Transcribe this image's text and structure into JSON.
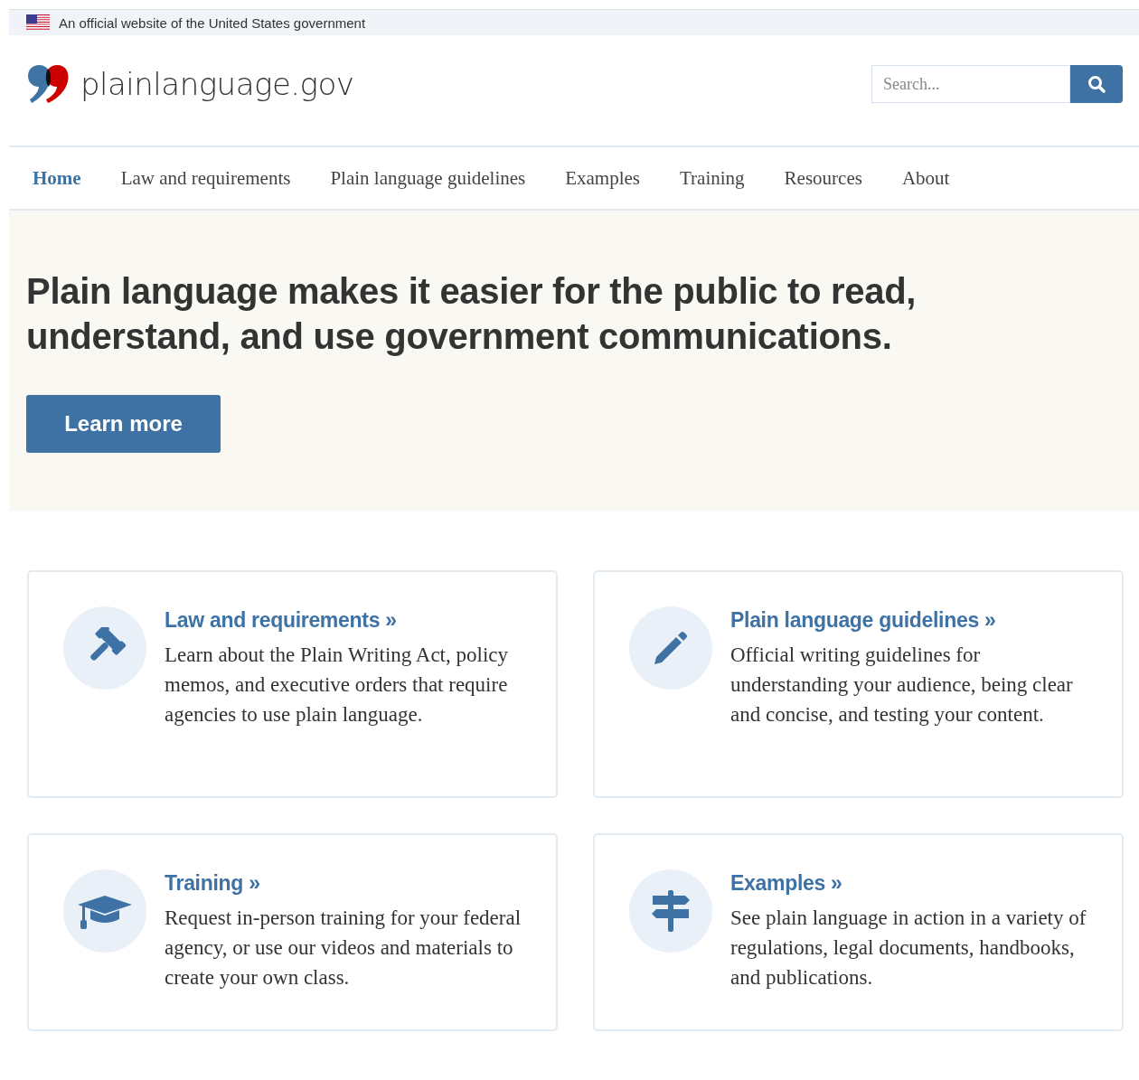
{
  "banner": {
    "text": "An official website of the United States government"
  },
  "header": {
    "site_name": "plainlanguage.gov",
    "search": {
      "placeholder": "Search..."
    }
  },
  "nav": [
    {
      "label": "Home",
      "selected": true
    },
    {
      "label": "Law and requirements",
      "selected": false
    },
    {
      "label": "Plain language guidelines",
      "selected": false
    },
    {
      "label": "Examples",
      "selected": false
    },
    {
      "label": "Training",
      "selected": false
    },
    {
      "label": "Resources",
      "selected": false
    },
    {
      "label": "About",
      "selected": false
    }
  ],
  "hero": {
    "heading": "Plain language makes it easier for the public to read, understand, and use government communications.",
    "button": "Learn more"
  },
  "cards": [
    {
      "kind": "gavel",
      "title": "Law and requirements »",
      "text": "Learn about the Plain Writing Act, policy memos, and executive orders that require agencies to use plain language."
    },
    {
      "kind": "pencil",
      "title": "Plain language guidelines »",
      "text": "Official writing guidelines for understanding your audience, being clear and concise, and testing your content."
    },
    {
      "kind": "cap",
      "title": "Training »",
      "text": "Request in-person training for your federal agency, or use our videos and materials to create your own class."
    },
    {
      "kind": "signpost",
      "title": "Examples »",
      "text": "See plain language in action in a variety of regulations, legal documents, handbooks, and publications."
    }
  ]
}
